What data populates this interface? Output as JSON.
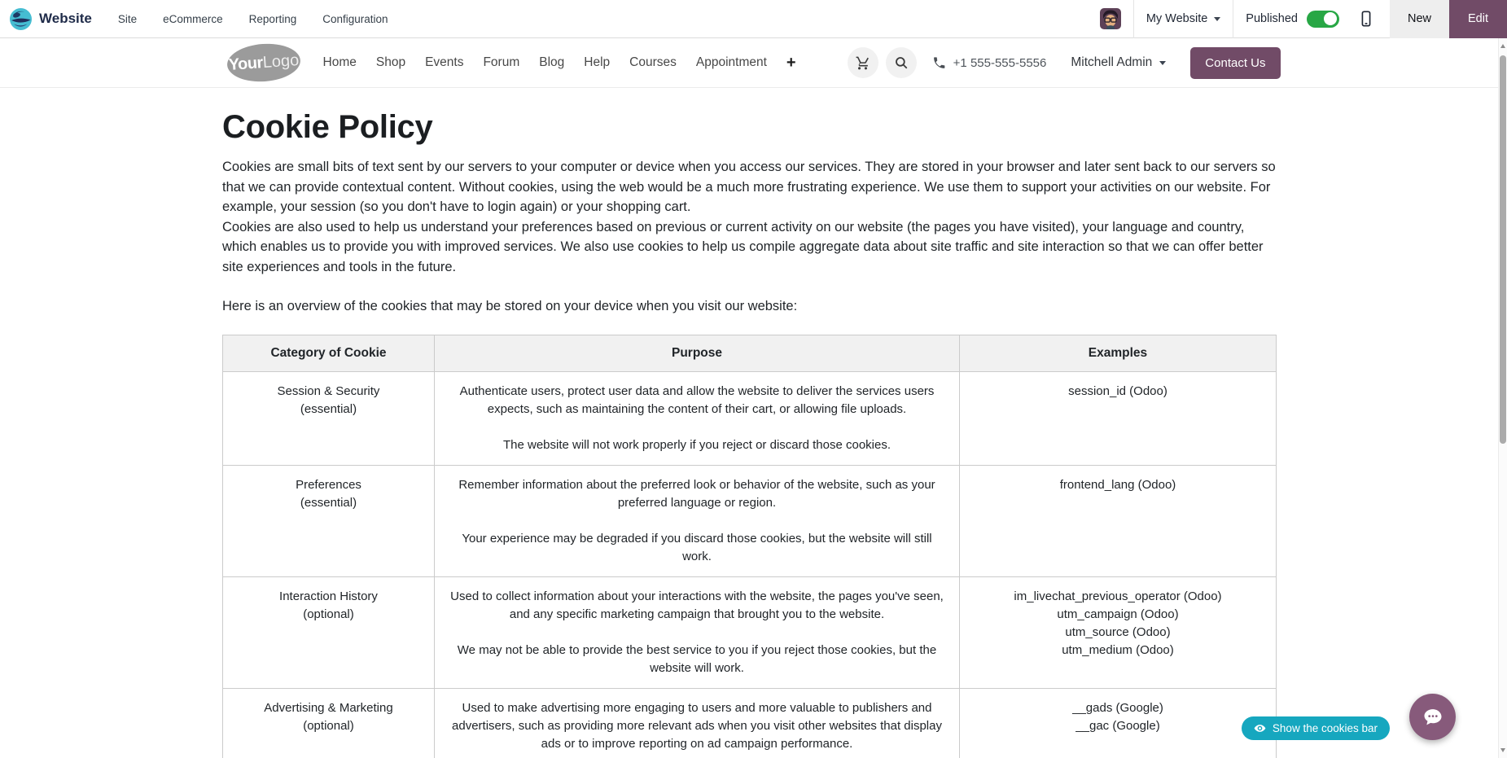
{
  "admin_bar": {
    "brand": "Website",
    "menus": [
      "Site",
      "eCommerce",
      "Reporting",
      "Configuration"
    ],
    "website_selector": "My Website",
    "published_label": "Published",
    "new_button": "New",
    "edit_button": "Edit"
  },
  "site_header": {
    "logo_your": "Your",
    "logo_logo": "Logo",
    "menu": [
      "Home",
      "Shop",
      "Events",
      "Forum",
      "Blog",
      "Help",
      "Courses",
      "Appointment"
    ],
    "plus_glyph": "+",
    "phone": "+1 555-555-5556",
    "user": "Mitchell Admin",
    "contact_button": "Contact Us"
  },
  "page": {
    "title": "Cookie Policy",
    "intro_1": "Cookies are small bits of text sent by our servers to your computer or device when you access our services. They are stored in your browser and later sent back to our servers so that we can provide contextual content. Without cookies, using the web would be a much more frustrating experience. We use them to support your activities on our website. For example, your session (so you don't have to login again) or your shopping cart.",
    "intro_2": "Cookies are also used to help us understand your preferences based on previous or current activity on our website (the pages you have visited), your language and country, which enables us to provide you with improved services. We also use cookies to help us compile aggregate data about site traffic and site interaction so that we can offer better site experiences and tools in the future.",
    "overview_line": "Here is an overview of the cookies that may be stored on your device when you visit our website:",
    "table": {
      "headers": [
        "Category of Cookie",
        "Purpose",
        "Examples"
      ],
      "rows": [
        {
          "category": "Session & Security",
          "qualifier": "(essential)",
          "purpose_1": "Authenticate users, protect user data and allow the website to deliver the services users expects, such as maintaining the content of their cart, or allowing file uploads.",
          "purpose_2": "The website will not work properly if you reject or discard those cookies.",
          "examples": [
            "session_id (Odoo)"
          ]
        },
        {
          "category": "Preferences",
          "qualifier": "(essential)",
          "purpose_1": "Remember information about the preferred look or behavior of the website, such as your preferred language or region.",
          "purpose_2": "Your experience may be degraded if you discard those cookies, but the website will still work.",
          "examples": [
            "frontend_lang (Odoo)"
          ]
        },
        {
          "category": "Interaction History",
          "qualifier": "(optional)",
          "purpose_1": "Used to collect information about your interactions with the website, the pages you've seen, and any specific marketing campaign that brought you to the website.",
          "purpose_2": "We may not be able to provide the best service to you if you reject those cookies, but the website will work.",
          "examples": [
            "im_livechat_previous_operator (Odoo)",
            "utm_campaign (Odoo)",
            "utm_source (Odoo)",
            "utm_medium (Odoo)"
          ]
        },
        {
          "category": "Advertising & Marketing",
          "qualifier": "(optional)",
          "purpose_1": "Used to make advertising more engaging to users and more valuable to publishers and advertisers, such as providing more relevant ads when you visit other websites that display ads or to improve reporting on ad campaign performance.",
          "purpose_2": "",
          "examples": [
            "__gads (Google)",
            "__gac (Google)"
          ]
        }
      ]
    }
  },
  "floating": {
    "cookies_bar_button": "Show the cookies bar"
  },
  "icons": {
    "cart": "cart-icon",
    "search": "search-icon",
    "phone": "phone-icon",
    "mobile": "mobile-preview-icon",
    "plus": "plus-icon",
    "eye": "eye-icon",
    "livechat": "livechat-icon",
    "caret": "chevron-down-icon"
  },
  "colors": {
    "primary": "#714B67",
    "toggle_on": "#28a745",
    "cookies_button": "#16a7bf",
    "livechat_button": "#875A7B",
    "table_header_bg": "#f1f1f1"
  }
}
